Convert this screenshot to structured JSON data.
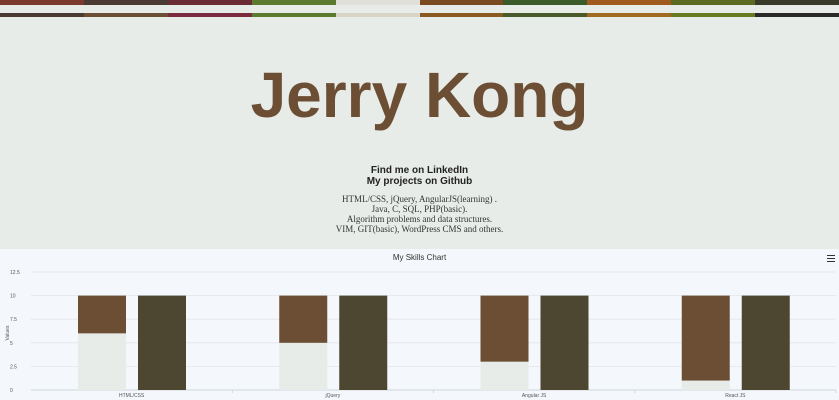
{
  "colors": {
    "background": "#e8ece8",
    "title": "#6b4e33",
    "bar_brown": "#6b4e33",
    "bar_dark": "#4d4631",
    "bar_light": "#e8ece8"
  },
  "header": {
    "title": "Jerry Kong",
    "links": [
      "Find me on LinkedIn",
      "My projects on Github"
    ]
  },
  "skills": [
    "HTML/CSS, jQuery, AngularJS(learning) .",
    "Java, C, SQL, PHP(basic).",
    "Algorithm problems and data structures.",
    "VIM, GIT(basic), WordPress CMS and others."
  ],
  "chart_data": {
    "type": "bar",
    "title": "My Skills Chart",
    "ylabel": "Values",
    "xlabel": "",
    "ylim": [
      0,
      12.5
    ],
    "yticks": [
      "0",
      "2.5",
      "5",
      "7.5",
      "10",
      "12.5"
    ],
    "categories": [
      "HTML/CSS",
      "jQuery",
      "Angular JS",
      "React JS"
    ],
    "series": [
      {
        "values": [
          6,
          5,
          3,
          1
        ],
        "color": "#e8ece8",
        "stack": "a"
      },
      {
        "values": [
          4,
          5,
          7,
          9
        ],
        "color": "#6b4e33",
        "stack": "a"
      },
      {
        "values": [
          10,
          10,
          10,
          10
        ],
        "color": "#4d4631",
        "stack": "b"
      }
    ],
    "grid": true,
    "legend": "none"
  }
}
